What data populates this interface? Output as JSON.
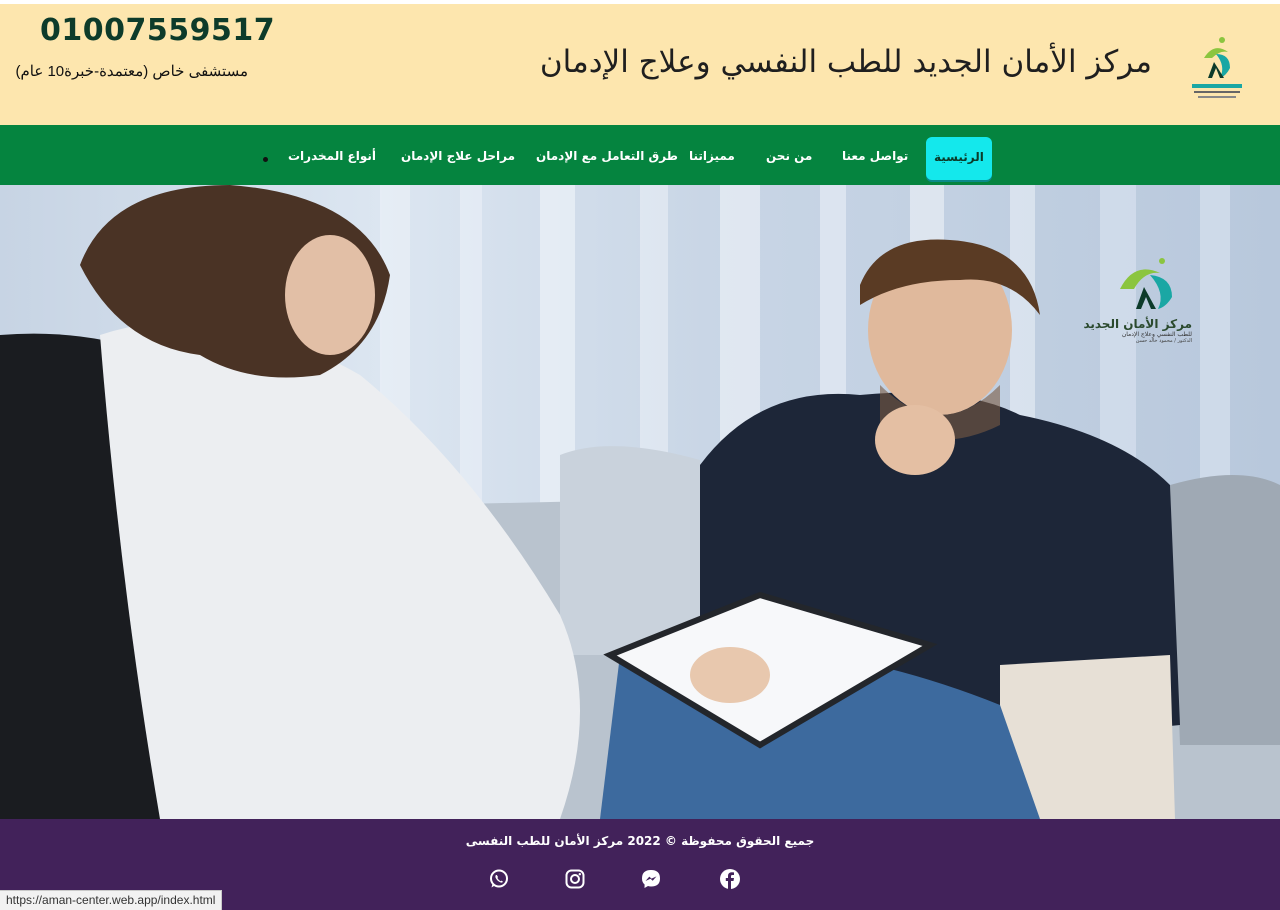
{
  "header": {
    "logo_text": "مركز الأمان الجديد",
    "site_title": "مركز الأمان الجديد للطب النفسي وعلاج الإدمان",
    "phone": "01007559517",
    "tagline": "مستشفى خاص (معتمدة-خبرة10 عام)"
  },
  "nav": {
    "items": [
      "الرئيسية",
      "تواصل معنا",
      "من نحن",
      "مميزاتنا",
      "طرق التعامل مع الإدمان",
      "مراحل علاج الإدمان",
      "أنواع المخدرات"
    ],
    "active_index": 0
  },
  "hero": {
    "watermark_title": "مركز الأمان الجديد",
    "watermark_line1": "للطب النفسي وعلاج الإدمان",
    "watermark_line2": "الدكتور / محمود خالد حسن"
  },
  "footer": {
    "copyright": "جميع الحقوق محفوظة © 2022 مركز الأمان للطب النفسى",
    "social_icons": [
      "facebook-icon",
      "messenger-icon",
      "instagram-icon",
      "whatsapp-icon"
    ]
  },
  "status_bar": {
    "url": "https://aman-center.web.app/index.html"
  },
  "colors": {
    "header_bg": "#fde6ae",
    "nav_bg": "#05843f",
    "nav_active_bg": "#14e8ec",
    "footer_bg": "#42225a"
  }
}
